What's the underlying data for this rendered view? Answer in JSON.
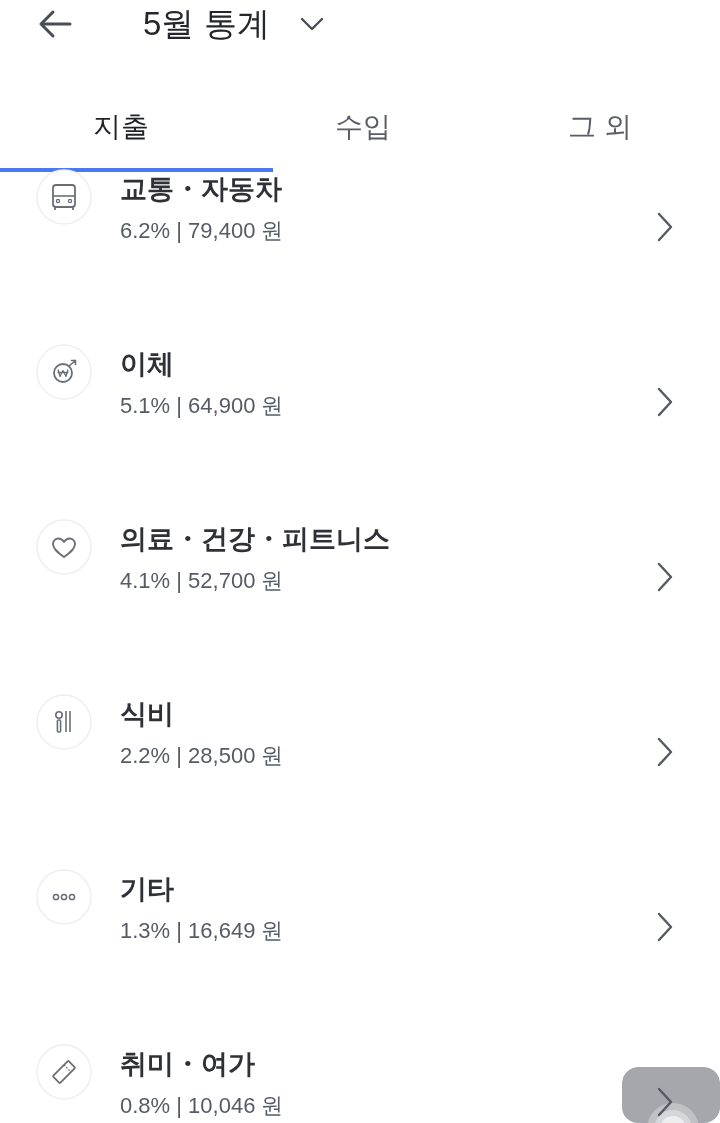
{
  "header": {
    "title": "5월 통계"
  },
  "tabs": [
    {
      "label": "지출",
      "selected": true
    },
    {
      "label": "수입",
      "selected": false
    },
    {
      "label": "그 외",
      "selected": false
    }
  ],
  "categories": [
    {
      "kind": "bus",
      "name": "교통・자동차",
      "detail": "6.2% | 79,400 원"
    },
    {
      "kind": "transfer",
      "name": "이체",
      "detail": "5.1% | 64,900 원"
    },
    {
      "kind": "health",
      "name": "의료・건강・피트니스",
      "detail": "4.1% | 52,700 원"
    },
    {
      "kind": "food",
      "name": "식비",
      "detail": "2.2% | 28,500 원"
    },
    {
      "kind": "other",
      "name": "기타",
      "detail": "1.3% | 16,649 원"
    },
    {
      "kind": "hobby",
      "name": "취미・여가",
      "detail": "0.8% | 10,046 원"
    }
  ]
}
